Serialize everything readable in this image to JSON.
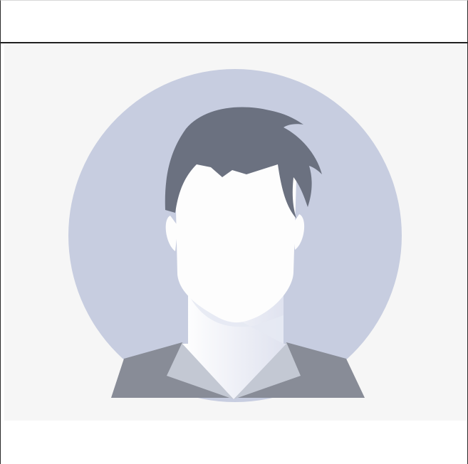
{
  "image": {
    "alt": "",
    "icon": "default-avatar-icon"
  },
  "colors": {
    "panel_background": "#f6f6f6",
    "circle": "#c7cde0",
    "hair": "#6b7180",
    "face": "#fdfdfd",
    "jacket": "#888c97",
    "lapel": "#c3c8d3",
    "shirt": "#f3f3f5"
  }
}
